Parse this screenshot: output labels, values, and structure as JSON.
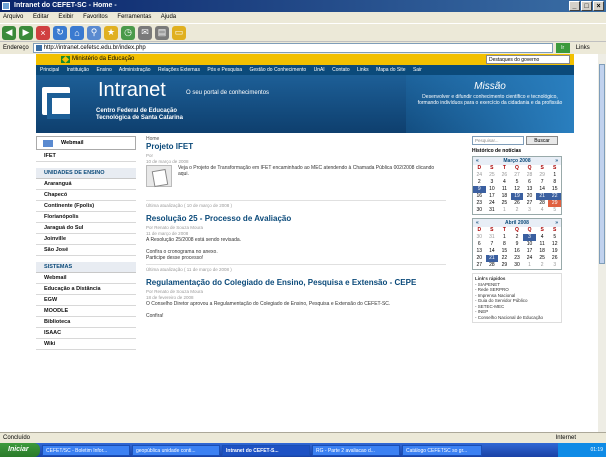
{
  "window": {
    "title": "Intranet do CEFET-SC - Home -"
  },
  "menu": [
    "Arquivo",
    "Editar",
    "Exibir",
    "Favoritos",
    "Ferramentas",
    "Ajuda"
  ],
  "address": {
    "label": "Endereço",
    "url": "http://intranet.cefetsc.edu.br/index.php",
    "go": "Ir",
    "links": "Links"
  },
  "gov": {
    "ministry": "Ministério da Educação",
    "select": "Destaques do governo"
  },
  "topnav": [
    "Principal",
    "Instituição",
    "Ensino",
    "Administração",
    "Relações Externas",
    "Pós e Pesquisa",
    "Gestão do Conhecimento",
    "UnAI",
    "Contato",
    "Links",
    "Mapa do Site",
    "Sair"
  ],
  "header": {
    "intranet": "Intranet",
    "slogan": "O seu portal de conhecimentos",
    "cefet1": "Centro Federal de Educação",
    "cefet2": "Tecnológica de Santa Catarina",
    "missao_title": "Missão",
    "missao_text": "Desenvolver e difundir conhecimento científico e tecnológico, formando indivíduos para o exercício da cidadania e da profissão"
  },
  "sidebar": {
    "webmail": "Webmail",
    "ifet": "IFET",
    "units_head": "UNIDADES DE ENSINO",
    "units": [
      "Araranguá",
      "Chapecó",
      "Continente (Fpolis)",
      "Florianópolis",
      "Jaraguá do Sul",
      "Joinville",
      "São José"
    ],
    "systems_head": "SISTEMAS",
    "systems": [
      "Webmail",
      "Educação a Distância",
      "EGW",
      "MOODLE",
      "Biblioteca",
      "ISAAC",
      "Wiki"
    ]
  },
  "content": {
    "crumb": "Home",
    "posts": [
      {
        "title": "Projeto IFET",
        "author": "Por",
        "date": "10 de março de 2008",
        "text": "Veja o Projeto de Transformação em IFET encaminhado ao MEC atendendo à Chamada Pública 002/2008 clicando aqui.",
        "updated": "Última atualização ( 10 de março de 2008 )"
      },
      {
        "title": "Resolução 25 - Processo de Avaliação",
        "author": "Por Renato de Souza Moura",
        "date": "11 de março de 2008",
        "text": "A Resolução 25/2008 está sendo revisada.",
        "extra1": "Confira o cronograma no anexo.",
        "extra2": "Participe desse processo!",
        "updated": "Última atualização ( 11 de março de 2008 )"
      },
      {
        "title": "Regulamentação do Colegiado de Ensino, Pesquisa e Extensão - CEPE",
        "author": "Por Renato de Souza Moura",
        "date": "18 de fevereiro de 2008",
        "text": "O Conselho Diretor aprovou a Regulamentação do Colegiado de Ensino, Pesquisa e Extensão do CEFET-SC.",
        "extra1": "Confira!"
      }
    ]
  },
  "rightcol": {
    "search_placeholder": "Pesquisar...",
    "search_btn": "Buscar",
    "history": "Histórico de notícias",
    "cal1": {
      "month": "Março 2008"
    },
    "cal2": {
      "month": "Abril 2008"
    },
    "days": [
      "D",
      "S",
      "T",
      "Q",
      "Q",
      "S",
      "S"
    ],
    "links_head": "Link's rápidos",
    "links": [
      "- SIAPENET",
      "- Rede SERPRO",
      "- Imprensa Nacional",
      "- Guia do Servidor Público",
      "- SETEC-MEC",
      "- INEP",
      "- Conselho Nacional de Educação"
    ]
  },
  "status": {
    "text": "Concluído",
    "zone": "Internet"
  },
  "taskbar": {
    "start": "Iniciar",
    "tasks": [
      "CEFET/SC - Boletim Infor...",
      "geopública unidade conti...",
      "Intranet do CEFET-S...",
      "RG - Parte 2 avaliacao d...",
      "Catálogo CEFETSC so gr..."
    ],
    "clock": "01:19"
  },
  "colors": {
    "accent": "#0b4a7a",
    "gov": "#f2c000",
    "header": "#1d5f97"
  }
}
